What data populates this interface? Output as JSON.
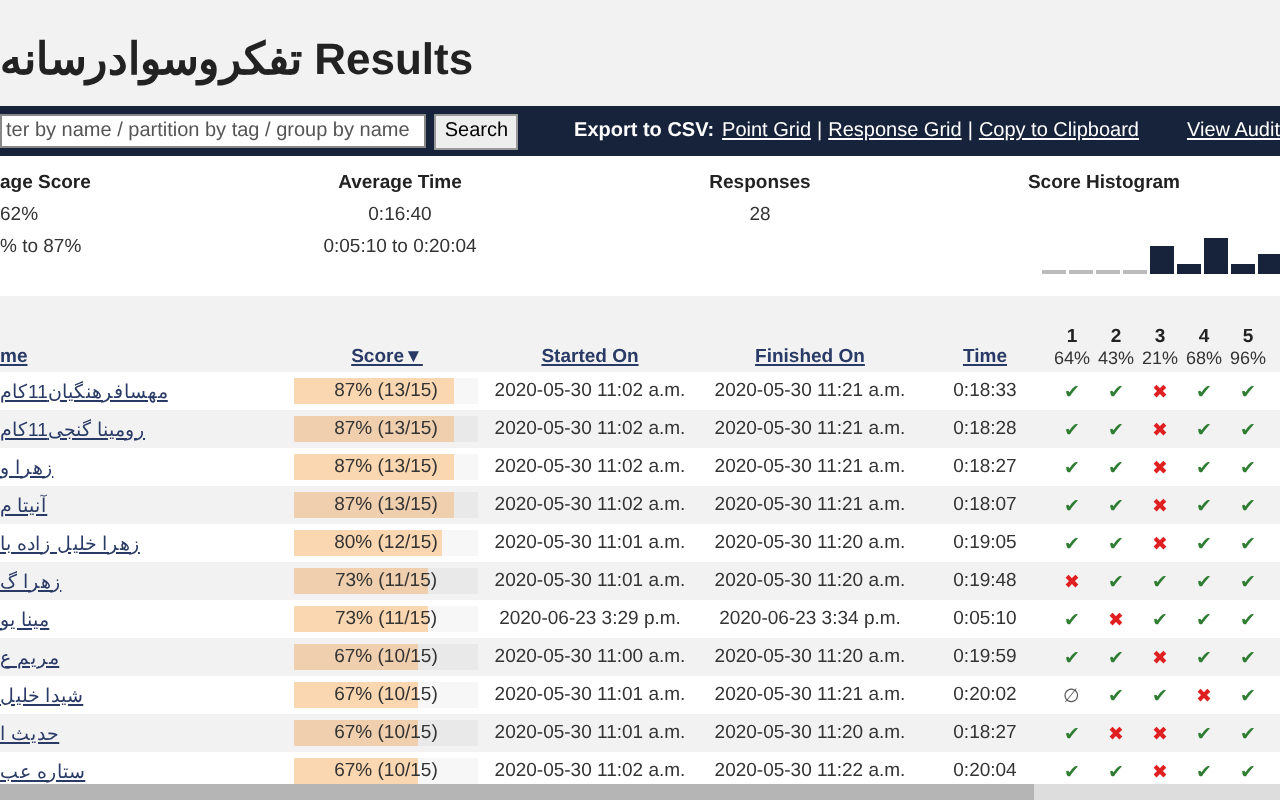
{
  "title": {
    "persian": "تفکروسوادرسانه",
    "text": "Results"
  },
  "toolbar": {
    "search": {
      "placeholder": "ter by name / partition by tag / group by name"
    },
    "search_button": "Search",
    "export_label": "Export to CSV:",
    "export_links": [
      "Point Grid",
      "Response Grid",
      "Copy to Clipboard"
    ],
    "separator": "|",
    "audit_link": "View Audit"
  },
  "stats": [
    {
      "label": "age Score",
      "values": [
        "62%",
        "% to 87%"
      ]
    },
    {
      "label": "Average Time",
      "values": [
        "0:16:40",
        "0:05:10 to 0:20:04"
      ]
    },
    {
      "label": "Responses",
      "values": [
        "28"
      ]
    },
    {
      "label": "Score Histogram"
    }
  ],
  "table": {
    "columns": [
      "me",
      "Score▼",
      "Started On",
      "Finished On",
      "Time"
    ],
    "questions": [
      {
        "number": "1",
        "percent": "64%"
      },
      {
        "number": "2",
        "percent": "43%"
      },
      {
        "number": "3",
        "percent": "21%"
      },
      {
        "number": "4",
        "percent": "68%"
      },
      {
        "number": "5",
        "percent": "96%"
      }
    ],
    "rows": [
      {
        "name": "مهسافرهنگیان11کام",
        "score": "87% (13/15)",
        "level": 0.87,
        "started": "2020-05-30 11:02 a.m.",
        "finished": "2020-05-30 11:21 a.m.",
        "time": "0:18:33",
        "answers": [
          {
            "kind": "correct",
            "mark": "✔"
          },
          {
            "kind": "correct",
            "mark": "✔"
          },
          {
            "kind": "wrong",
            "mark": "✖"
          },
          {
            "kind": "correct",
            "mark": "✔"
          },
          {
            "kind": "correct",
            "mark": "✔"
          }
        ]
      },
      {
        "name": "رومینا گنجی11کام",
        "score": "87% (13/15)",
        "level": 0.87,
        "started": "2020-05-30 11:02 a.m.",
        "finished": "2020-05-30 11:21 a.m.",
        "time": "0:18:28",
        "answers": [
          {
            "kind": "correct",
            "mark": "✔"
          },
          {
            "kind": "correct",
            "mark": "✔"
          },
          {
            "kind": "wrong",
            "mark": "✖"
          },
          {
            "kind": "correct",
            "mark": "✔"
          },
          {
            "kind": "correct",
            "mark": "✔"
          }
        ]
      },
      {
        "name": "زهرا و",
        "score": "87% (13/15)",
        "level": 0.87,
        "started": "2020-05-30 11:02 a.m.",
        "finished": "2020-05-30 11:21 a.m.",
        "time": "0:18:27",
        "answers": [
          {
            "kind": "correct",
            "mark": "✔"
          },
          {
            "kind": "correct",
            "mark": "✔"
          },
          {
            "kind": "wrong",
            "mark": "✖"
          },
          {
            "kind": "correct",
            "mark": "✔"
          },
          {
            "kind": "correct",
            "mark": "✔"
          }
        ]
      },
      {
        "name": "آنیتا م",
        "score": "87% (13/15)",
        "level": 0.87,
        "started": "2020-05-30 11:02 a.m.",
        "finished": "2020-05-30 11:21 a.m.",
        "time": "0:18:07",
        "answers": [
          {
            "kind": "correct",
            "mark": "✔"
          },
          {
            "kind": "correct",
            "mark": "✔"
          },
          {
            "kind": "wrong",
            "mark": "✖"
          },
          {
            "kind": "correct",
            "mark": "✔"
          },
          {
            "kind": "correct",
            "mark": "✔"
          }
        ]
      },
      {
        "name": "زهرا خلیل زاده با",
        "score": "80% (12/15)",
        "level": 0.8,
        "started": "2020-05-30 11:01 a.m.",
        "finished": "2020-05-30 11:20 a.m.",
        "time": "0:19:05",
        "answers": [
          {
            "kind": "correct",
            "mark": "✔"
          },
          {
            "kind": "correct",
            "mark": "✔"
          },
          {
            "kind": "wrong",
            "mark": "✖"
          },
          {
            "kind": "correct",
            "mark": "✔"
          },
          {
            "kind": "correct",
            "mark": "✔"
          }
        ]
      },
      {
        "name": "زهرا گ",
        "score": "73% (11/15)",
        "level": 0.73,
        "started": "2020-05-30 11:01 a.m.",
        "finished": "2020-05-30 11:20 a.m.",
        "time": "0:19:48",
        "answers": [
          {
            "kind": "wrong",
            "mark": "✖"
          },
          {
            "kind": "correct",
            "mark": "✔"
          },
          {
            "kind": "correct",
            "mark": "✔"
          },
          {
            "kind": "correct",
            "mark": "✔"
          },
          {
            "kind": "correct",
            "mark": "✔"
          }
        ]
      },
      {
        "name": "مینا یو",
        "score": "73% (11/15)",
        "level": 0.73,
        "started": "2020-06-23 3:29 p.m.",
        "finished": "2020-06-23 3:34 p.m.",
        "time": "0:05:10",
        "answers": [
          {
            "kind": "correct",
            "mark": "✔"
          },
          {
            "kind": "wrong",
            "mark": "✖"
          },
          {
            "kind": "correct",
            "mark": "✔"
          },
          {
            "kind": "correct",
            "mark": "✔"
          },
          {
            "kind": "correct",
            "mark": "✔"
          }
        ]
      },
      {
        "name": "مریم ع",
        "score": "67% (10/15)",
        "level": 0.67,
        "started": "2020-05-30 11:00 a.m.",
        "finished": "2020-05-30 11:20 a.m.",
        "time": "0:19:59",
        "answers": [
          {
            "kind": "correct",
            "mark": "✔"
          },
          {
            "kind": "correct",
            "mark": "✔"
          },
          {
            "kind": "wrong",
            "mark": "✖"
          },
          {
            "kind": "correct",
            "mark": "✔"
          },
          {
            "kind": "correct",
            "mark": "✔"
          }
        ]
      },
      {
        "name": "شیدا خلیل",
        "score": "67% (10/15)",
        "level": 0.67,
        "started": "2020-05-30 11:01 a.m.",
        "finished": "2020-05-30 11:21 a.m.",
        "time": "0:20:02",
        "answers": [
          {
            "kind": "blank",
            "mark": "∅"
          },
          {
            "kind": "correct",
            "mark": "✔"
          },
          {
            "kind": "correct",
            "mark": "✔"
          },
          {
            "kind": "wrong",
            "mark": "✖"
          },
          {
            "kind": "correct",
            "mark": "✔"
          }
        ]
      },
      {
        "name": "حدیث ا",
        "score": "67% (10/15)",
        "level": 0.67,
        "started": "2020-05-30 11:01 a.m.",
        "finished": "2020-05-30 11:20 a.m.",
        "time": "0:18:27",
        "answers": [
          {
            "kind": "correct",
            "mark": "✔"
          },
          {
            "kind": "wrong",
            "mark": "✖"
          },
          {
            "kind": "wrong",
            "mark": "✖"
          },
          {
            "kind": "correct",
            "mark": "✔"
          },
          {
            "kind": "correct",
            "mark": "✔"
          }
        ]
      },
      {
        "name": "ستاره عب",
        "score": "67% (10/15)",
        "level": 0.67,
        "started": "2020-05-30 11:02 a.m.",
        "finished": "2020-05-30 11:22 a.m.",
        "time": "0:20:04",
        "answers": [
          {
            "kind": "correct",
            "mark": "✔"
          },
          {
            "kind": "correct",
            "mark": "✔"
          },
          {
            "kind": "wrong",
            "mark": "✖"
          },
          {
            "kind": "correct",
            "mark": "✔"
          },
          {
            "kind": "correct",
            "mark": "✔"
          }
        ]
      }
    ]
  }
}
